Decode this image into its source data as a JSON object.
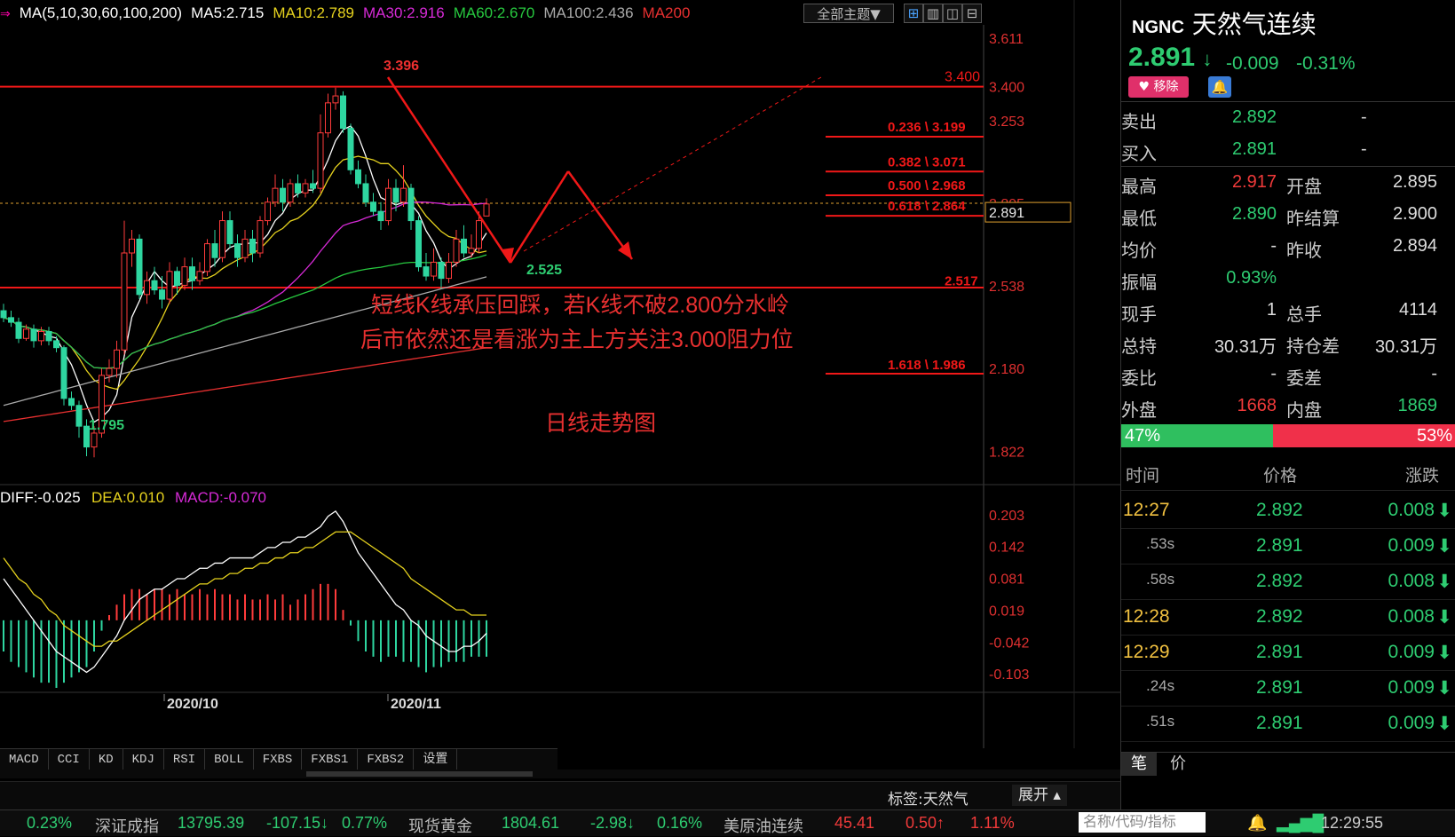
{
  "ma_legend": {
    "icon_text": "⇒",
    "items": [
      {
        "label": "MA(5,10,30,60,100,200)",
        "color": "#ffffff"
      },
      {
        "label": "MA5:2.715",
        "color": "#ffffff"
      },
      {
        "label": "MA10:2.789",
        "color": "#e6d21e"
      },
      {
        "label": "MA30:2.916",
        "color": "#d72ad7"
      },
      {
        "label": "MA60:2.670",
        "color": "#27c93f"
      },
      {
        "label": "MA100:2.436",
        "color": "#aaaaaa"
      },
      {
        "label": "MA200",
        "color": "#e83030"
      }
    ]
  },
  "toolbar": {
    "theme_select": "全部主题▼"
  },
  "price_axis": [
    "3.611",
    "3.400",
    "3.253",
    "2.895",
    "2.891",
    "2.538",
    "2.180",
    "1.822"
  ],
  "fib_levels": [
    "0.236 \\ 3.199",
    "0.382 \\ 3.071",
    "0.500 \\ 2.968",
    "0.618 \\ 2.864",
    "2.517",
    "1.618 \\ 1.986"
  ],
  "annotations": {
    "high_label": "3.396",
    "low_label": "1.795",
    "recent_low": "2.525",
    "comment_line1": "短线K线承压回踩，若K线不破2.800分水岭",
    "comment_line2": "后市依然还是看涨为主上方关注3.000阻力位",
    "chart_caption": "日线走势图"
  },
  "macd": {
    "diff": "DIFF:-0.025",
    "dea": "DEA:0.010",
    "macd": "MACD:-0.070",
    "axis": [
      "0.203",
      "0.142",
      "0.081",
      "0.019",
      "-0.042",
      "-0.103"
    ]
  },
  "date_axis": [
    "2020/10",
    "2020/11"
  ],
  "indicator_tabs": [
    "MACD",
    "CCI",
    "KD",
    "KDJ",
    "RSI",
    "BOLL",
    "FXBS",
    "FXBS1",
    "FXBS2",
    "设置"
  ],
  "bottom_labels": {
    "tag": "标签:天然气",
    "expand": "展开"
  },
  "quote": {
    "symbol": "NGNC",
    "name": "天然气连续",
    "price": "2.891",
    "change": "-0.009",
    "change_pct": "-0.31%",
    "remove_label": "移除",
    "sell": {
      "label": "卖出",
      "price": "2.892",
      "vol": "-"
    },
    "buy": {
      "label": "买入",
      "price": "2.891",
      "vol": "-"
    },
    "stats": [
      [
        "最高",
        "2.917",
        "开盘",
        "2.895"
      ],
      [
        "最低",
        "2.890",
        "昨结算",
        "2.900"
      ],
      [
        "均价",
        "-",
        "昨收",
        "2.894"
      ],
      [
        "振幅",
        "0.93%",
        "",
        ""
      ],
      [
        "现手",
        "1",
        "总手",
        "4114"
      ],
      [
        "总持",
        "30.31万",
        "持仓差",
        "30.31万"
      ],
      [
        "委比",
        "-",
        "委差",
        "-"
      ],
      [
        "外盘",
        "1668",
        "内盘",
        "1869"
      ]
    ],
    "buy_pct": "47%",
    "sell_pct": "53%",
    "tick_headers": [
      "时间",
      "价格",
      "涨跌"
    ],
    "ticks": [
      {
        "time": "12:27",
        "price": "2.892",
        "chg": "0.008"
      },
      {
        "time": ".53s",
        "price": "2.891",
        "chg": "0.009"
      },
      {
        "time": ".58s",
        "price": "2.892",
        "chg": "0.008"
      },
      {
        "time": "12:28",
        "price": "2.892",
        "chg": "0.008"
      },
      {
        "time": "12:29",
        "price": "2.891",
        "chg": "0.009"
      },
      {
        "time": ".24s",
        "price": "2.891",
        "chg": "0.009"
      },
      {
        "time": ".51s",
        "price": "2.891",
        "chg": "0.009"
      }
    ],
    "tabs": [
      "笔",
      "价"
    ]
  },
  "status_bar": {
    "items": [
      "0.23%",
      "深证成指",
      "13795.39",
      "-107.15↓",
      "0.77%",
      "现货黄金",
      "1804.61",
      "-2.98↓",
      "0.16%",
      "美原油连续",
      "45.41",
      "0.50↑",
      "1.11%"
    ],
    "search_placeholder": "名称/代码/指标",
    "clock": "12:29:55"
  },
  "chart_data": {
    "type": "candlestick",
    "symbol": "NGNC",
    "period": "daily",
    "ylim": [
      1.7,
      3.66
    ],
    "x_ticks": [
      "2020/10",
      "2020/11"
    ],
    "candles": [
      [
        2.43,
        2.4,
        2.46,
        2.38
      ],
      [
        2.4,
        2.38,
        2.43,
        2.36
      ],
      [
        2.38,
        2.31,
        2.4,
        2.29
      ],
      [
        2.31,
        2.35,
        2.37,
        2.3
      ],
      [
        2.35,
        2.3,
        2.37,
        2.27
      ],
      [
        2.3,
        2.34,
        2.36,
        2.28
      ],
      [
        2.34,
        2.3,
        2.36,
        2.28
      ],
      [
        2.3,
        2.27,
        2.32,
        2.25
      ],
      [
        2.27,
        2.05,
        2.28,
        2.02
      ],
      [
        2.05,
        2.02,
        2.08,
        2.0
      ],
      [
        2.02,
        1.93,
        2.04,
        1.88
      ],
      [
        1.93,
        1.84,
        1.96,
        1.8
      ],
      [
        1.84,
        1.9,
        1.93,
        1.795
      ],
      [
        1.9,
        2.15,
        2.18,
        1.88
      ],
      [
        2.15,
        2.18,
        2.22,
        2.12
      ],
      [
        2.18,
        2.26,
        2.3,
        2.14
      ],
      [
        2.26,
        2.68,
        2.82,
        2.24
      ],
      [
        2.68,
        2.74,
        2.78,
        2.62
      ],
      [
        2.74,
        2.5,
        2.76,
        2.48
      ],
      [
        2.5,
        2.56,
        2.6,
        2.46
      ],
      [
        2.56,
        2.52,
        2.62,
        2.5
      ],
      [
        2.52,
        2.48,
        2.58,
        2.44
      ],
      [
        2.48,
        2.6,
        2.64,
        2.46
      ],
      [
        2.6,
        2.54,
        2.62,
        2.5
      ],
      [
        2.54,
        2.62,
        2.66,
        2.52
      ],
      [
        2.62,
        2.56,
        2.66,
        2.52
      ],
      [
        2.56,
        2.6,
        2.64,
        2.54
      ],
      [
        2.6,
        2.72,
        2.74,
        2.58
      ],
      [
        2.72,
        2.66,
        2.78,
        2.62
      ],
      [
        2.66,
        2.82,
        2.86,
        2.64
      ],
      [
        2.82,
        2.72,
        2.86,
        2.7
      ],
      [
        2.72,
        2.66,
        2.76,
        2.62
      ],
      [
        2.66,
        2.74,
        2.78,
        2.64
      ],
      [
        2.74,
        2.68,
        2.78,
        2.64
      ],
      [
        2.68,
        2.82,
        2.84,
        2.66
      ],
      [
        2.82,
        2.9,
        2.92,
        2.8
      ],
      [
        2.9,
        2.96,
        3.02,
        2.88
      ],
      [
        2.96,
        2.9,
        3.0,
        2.86
      ],
      [
        2.9,
        2.98,
        3.0,
        2.88
      ],
      [
        2.98,
        2.94,
        3.02,
        2.92
      ],
      [
        2.94,
        2.98,
        3.0,
        2.92
      ],
      [
        2.98,
        2.96,
        3.04,
        2.94
      ],
      [
        2.96,
        3.2,
        3.28,
        2.94
      ],
      [
        3.2,
        3.33,
        3.37,
        3.18
      ],
      [
        3.33,
        3.36,
        3.396,
        3.3
      ],
      [
        3.36,
        3.22,
        3.38,
        3.2
      ],
      [
        3.22,
        3.04,
        3.24,
        3.02
      ],
      [
        3.04,
        2.98,
        3.08,
        2.96
      ],
      [
        2.98,
        2.9,
        3.02,
        2.88
      ],
      [
        2.9,
        2.86,
        2.94,
        2.84
      ],
      [
        2.86,
        2.82,
        2.9,
        2.78
      ],
      [
        2.82,
        2.96,
        3.0,
        2.8
      ],
      [
        2.96,
        2.9,
        3.0,
        2.86
      ],
      [
        2.9,
        2.96,
        3.06,
        2.88
      ],
      [
        2.96,
        2.82,
        2.98,
        2.78
      ],
      [
        2.82,
        2.62,
        2.84,
        2.6
      ],
      [
        2.62,
        2.58,
        2.68,
        2.56
      ],
      [
        2.58,
        2.64,
        2.7,
        2.56
      ],
      [
        2.64,
        2.57,
        2.66,
        2.525
      ],
      [
        2.57,
        2.64,
        2.68,
        2.55
      ],
      [
        2.64,
        2.74,
        2.78,
        2.62
      ],
      [
        2.74,
        2.68,
        2.8,
        2.66
      ],
      [
        2.68,
        2.7,
        2.76,
        2.66
      ],
      [
        2.7,
        2.82,
        2.86,
        2.68
      ],
      [
        2.84,
        2.892,
        2.917,
        2.84
      ]
    ],
    "fib_levels": [
      3.199,
      3.071,
      2.968,
      2.864,
      2.517,
      1.986
    ],
    "resistance": 3.4,
    "support": 2.538,
    "current_price": 2.891,
    "macd_ylim": [
      -0.13,
      0.22
    ],
    "macd_values": [
      -0.06,
      -0.08,
      -0.09,
      -0.1,
      -0.11,
      -0.12,
      -0.12,
      -0.13,
      -0.12,
      -0.11,
      -0.1,
      -0.09,
      -0.06,
      -0.02,
      0.01,
      0.03,
      0.05,
      0.06,
      0.06,
      0.05,
      0.06,
      0.06,
      0.05,
      0.06,
      0.05,
      0.05,
      0.06,
      0.05,
      0.06,
      0.05,
      0.05,
      0.04,
      0.05,
      0.04,
      0.04,
      0.05,
      0.04,
      0.05,
      0.03,
      0.04,
      0.05,
      0.06,
      0.07,
      0.07,
      0.06,
      0.02,
      -0.01,
      -0.04,
      -0.06,
      -0.07,
      -0.08,
      -0.07,
      -0.07,
      -0.08,
      -0.08,
      -0.09,
      -0.1,
      -0.09,
      -0.09,
      -0.08,
      -0.08,
      -0.08,
      -0.07,
      -0.07,
      -0.07
    ],
    "diff_values": [
      0.08,
      0.06,
      0.04,
      0.02,
      0.0,
      -0.02,
      -0.04,
      -0.06,
      -0.07,
      -0.08,
      -0.09,
      -0.1,
      -0.09,
      -0.07,
      -0.05,
      -0.03,
      0.0,
      0.02,
      0.04,
      0.05,
      0.06,
      0.06,
      0.07,
      0.08,
      0.08,
      0.09,
      0.1,
      0.1,
      0.11,
      0.11,
      0.12,
      0.12,
      0.12,
      0.12,
      0.13,
      0.14,
      0.14,
      0.15,
      0.15,
      0.16,
      0.16,
      0.17,
      0.18,
      0.2,
      0.21,
      0.19,
      0.16,
      0.13,
      0.11,
      0.09,
      0.07,
      0.05,
      0.03,
      0.02,
      0.0,
      -0.01,
      -0.03,
      -0.04,
      -0.05,
      -0.06,
      -0.06,
      -0.05,
      -0.05,
      -0.04,
      -0.025
    ],
    "dea_values": [
      0.12,
      0.1,
      0.08,
      0.07,
      0.05,
      0.04,
      0.02,
      0.01,
      -0.01,
      -0.02,
      -0.03,
      -0.04,
      -0.05,
      -0.05,
      -0.04,
      -0.04,
      -0.03,
      -0.02,
      -0.01,
      0.0,
      0.01,
      0.02,
      0.03,
      0.04,
      0.05,
      0.06,
      0.07,
      0.07,
      0.08,
      0.08,
      0.09,
      0.09,
      0.1,
      0.1,
      0.11,
      0.11,
      0.12,
      0.12,
      0.13,
      0.13,
      0.14,
      0.14,
      0.15,
      0.16,
      0.17,
      0.17,
      0.17,
      0.16,
      0.15,
      0.14,
      0.13,
      0.12,
      0.11,
      0.1,
      0.08,
      0.07,
      0.06,
      0.05,
      0.04,
      0.03,
      0.02,
      0.02,
      0.01,
      0.01,
      0.01
    ]
  }
}
